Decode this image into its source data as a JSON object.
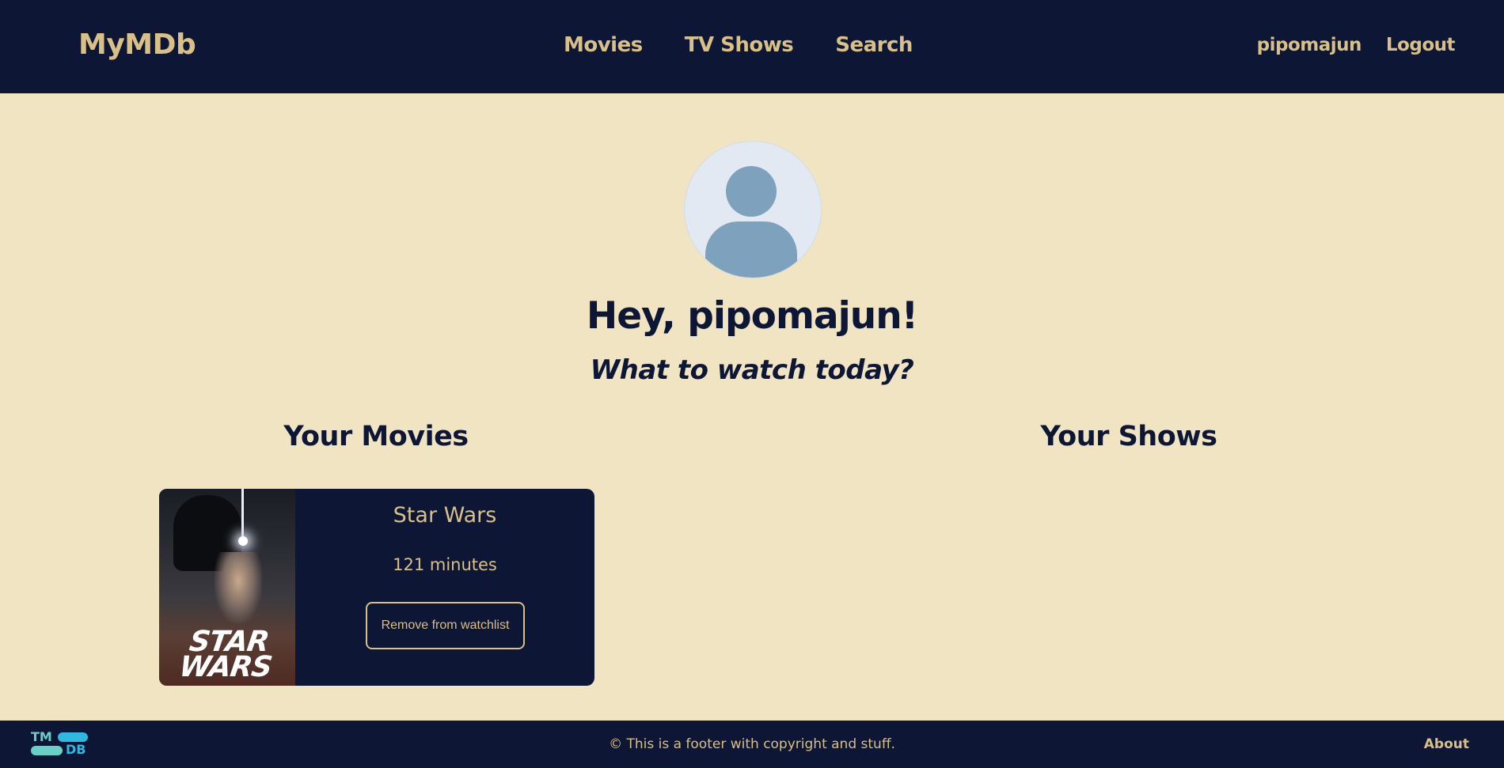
{
  "header": {
    "brand": "MyMDb",
    "nav": [
      "Movies",
      "TV Shows",
      "Search"
    ],
    "username": "pipomajun",
    "logout": "Logout"
  },
  "profile": {
    "greeting": "Hey, pipomajun!",
    "tagline": "What to watch today?"
  },
  "sections": {
    "movies_title": "Your Movies",
    "shows_title": "Your Shows"
  },
  "movies": [
    {
      "title": "Star Wars",
      "runtime": "121 minutes",
      "poster_logo": "STAR WARS",
      "remove_label": "Remove from watchlist"
    }
  ],
  "footer": {
    "tmdb_top": "TM",
    "tmdb_bottom": "DB",
    "copyright": "© This is a footer with copyright and stuff.",
    "about": "About"
  },
  "colors": {
    "navy": "#0e1636",
    "gold": "#d9bf88",
    "cream": "#f1e4c3"
  }
}
